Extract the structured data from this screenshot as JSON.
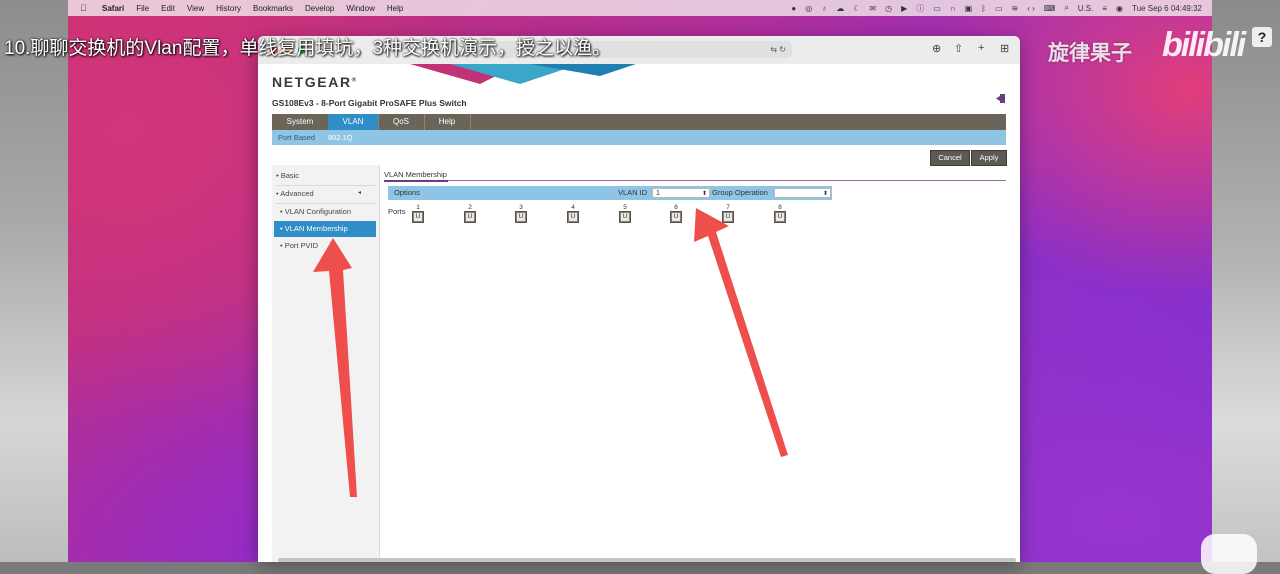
{
  "menubar": {
    "app": "Safari",
    "items": [
      "File",
      "Edit",
      "View",
      "History",
      "Bookmarks",
      "Develop",
      "Window",
      "Help"
    ],
    "input_source": "U.S.",
    "clock": "Tue Sep 6  04:49:32"
  },
  "overlay": {
    "caption": "10.聊聊交换机的Vlan配置，单线复用填坑，3种交换机演示，授之以渔。",
    "brand": "旋律果子",
    "bilibili": "bilibili",
    "help": "?"
  },
  "browser": {
    "icons": [
      "download-icon",
      "share-icon",
      "new-tab-icon",
      "tab-overview-icon",
      "translate-icon",
      "reload-icon"
    ]
  },
  "router_page": {
    "logo": "NETGEAR",
    "logo_mark": "®",
    "product": "GS108Ev3 - 8-Port Gigabit ProSAFE Plus Switch",
    "tabs": [
      {
        "label": "System",
        "active": false
      },
      {
        "label": "VLAN",
        "active": true
      },
      {
        "label": "QoS",
        "active": false
      },
      {
        "label": "Help",
        "active": false
      }
    ],
    "subtabs": [
      {
        "label": "Port Based",
        "active": false
      },
      {
        "label": "802.1Q",
        "active": true
      }
    ],
    "buttons": {
      "cancel": "Cancel",
      "apply": "Apply"
    },
    "nav": {
      "basic": "• Basic",
      "advanced": "• Advanced",
      "advanced_arrow": "◂",
      "vlan_configuration": "• VLAN Configuration",
      "vlan_membership": "• VLAN Membership",
      "port_pvid": "• Port PVID"
    },
    "section_title": "VLAN Membership",
    "options_label": "Options",
    "vlan_id_label": "VLAN ID",
    "vlan_id_value": "1",
    "group_operation_label": "Group Operation",
    "group_operation_value": "",
    "ports_label": "Ports",
    "ports": [
      {
        "num": "1",
        "state": "U"
      },
      {
        "num": "2",
        "state": "U"
      },
      {
        "num": "3",
        "state": "U"
      },
      {
        "num": "4",
        "state": "U"
      },
      {
        "num": "5",
        "state": "U"
      },
      {
        "num": "6",
        "state": "U"
      },
      {
        "num": "7",
        "state": "U"
      },
      {
        "num": "8",
        "state": "U"
      }
    ]
  },
  "colors": {
    "menu_bar": "#6a6459",
    "active_tab": "#2f8dc7",
    "sub_bar": "#8fc5e4",
    "annotation_arrow": "#ef4f4c"
  }
}
